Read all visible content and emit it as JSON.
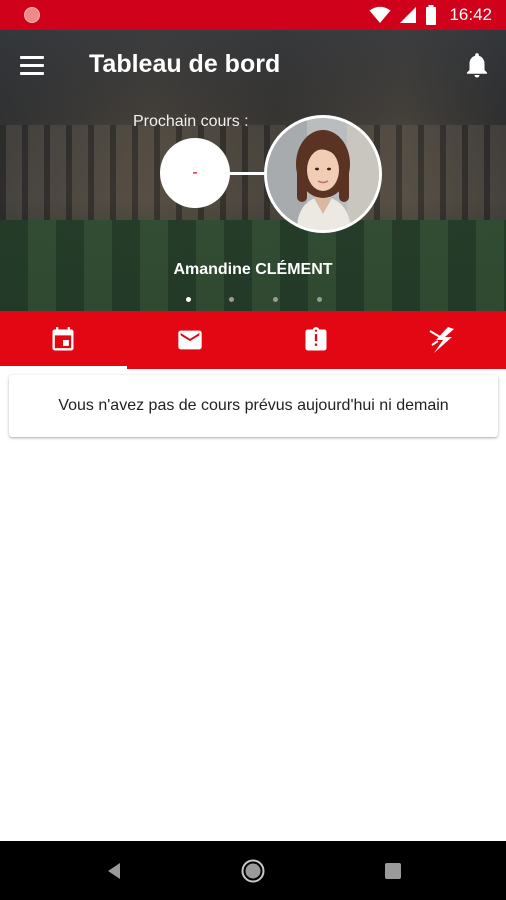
{
  "status_bar": {
    "time": "16:42",
    "icons": [
      "recording-dot-icon",
      "wifi-icon",
      "signal-icon",
      "battery-icon"
    ],
    "color": "#d0021b"
  },
  "header": {
    "title": "Tableau de bord",
    "menu_icon": "hamburger-menu-icon",
    "notification_icon": "bell-icon"
  },
  "next_course": {
    "label": "Prochain cours :",
    "value": "-",
    "teacher_name": "Amandine CLÉMENT",
    "pager_count": 4,
    "pager_active_index": 0
  },
  "tabs": [
    {
      "icon": "calendar-icon",
      "active": true
    },
    {
      "icon": "mail-icon",
      "active": false
    },
    {
      "icon": "clipboard-alert-icon",
      "active": false
    },
    {
      "icon": "lightning-icon",
      "active": false
    }
  ],
  "content": {
    "empty_message": "Vous n'avez pas de cours prévus aujourd'hui ni demain"
  },
  "navigation_bar": {
    "icons": [
      "back-icon",
      "home-icon",
      "recents-icon"
    ]
  },
  "colors": {
    "accent": "#e30613",
    "status_bar": "#d0021b",
    "nav_bar": "#000000"
  }
}
